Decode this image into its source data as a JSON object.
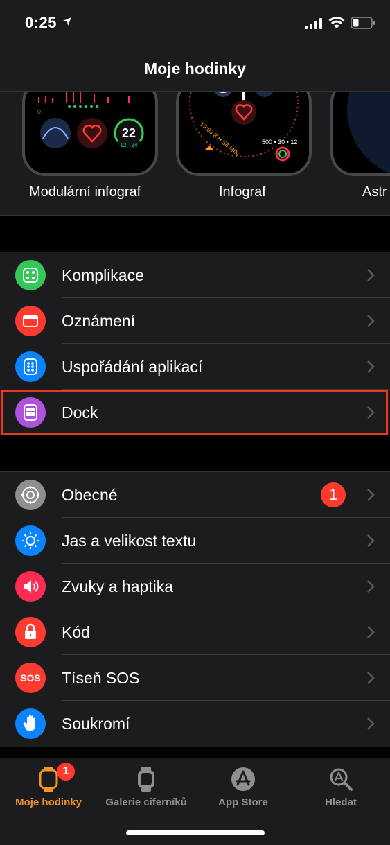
{
  "status": {
    "time": "0:25"
  },
  "nav": {
    "title": "Moje hodinky"
  },
  "faces": [
    {
      "label": "Modulární infograf",
      "complication_value": "22",
      "complication_min": "12",
      "complication_max": "24"
    },
    {
      "label": "Infograf",
      "sub_text": "19:03 8 H 54 MIN",
      "ring_values": "500 • 30 • 12"
    },
    {
      "label": "Astr"
    }
  ],
  "group1": [
    {
      "label": "Komplikace",
      "icon": "complications-icon",
      "color": "#34c759"
    },
    {
      "label": "Oznámení",
      "icon": "notifications-icon",
      "color": "#ff3b30"
    },
    {
      "label": "Uspořádání aplikací",
      "icon": "app-layout-icon",
      "color": "#0a84ff"
    },
    {
      "label": "Dock",
      "icon": "dock-icon",
      "color": "#af52de"
    }
  ],
  "group2": [
    {
      "label": "Obecné",
      "icon": "gear-icon",
      "color": "#8e8e93",
      "badge": "1"
    },
    {
      "label": "Jas a velikost textu",
      "icon": "brightness-icon",
      "color": "#0a84ff"
    },
    {
      "label": "Zvuky a haptika",
      "icon": "speaker-icon",
      "color": "#ff2d55"
    },
    {
      "label": "Kód",
      "icon": "lock-icon",
      "color": "#ff3b30"
    },
    {
      "label": "Tíseň SOS",
      "icon": "sos-icon",
      "color": "#ff3b30",
      "icon_text": "SOS"
    },
    {
      "label": "Soukromí",
      "icon": "hand-icon",
      "color": "#0a84ff"
    }
  ],
  "tabs": [
    {
      "label": "Moje hodinky",
      "icon": "watch-icon",
      "active": true,
      "badge": "1"
    },
    {
      "label": "Galerie ciferníků",
      "icon": "watch-face-gallery-icon",
      "active": false
    },
    {
      "label": "App Store",
      "icon": "app-store-icon",
      "active": false
    },
    {
      "label": "Hledat",
      "icon": "search-icon",
      "active": false
    }
  ],
  "colors": {
    "accent": "#f0952e",
    "highlight": "#e8391f",
    "background": "#1c1c1e"
  }
}
